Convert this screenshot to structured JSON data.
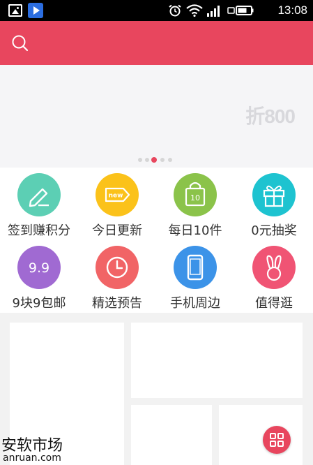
{
  "status_bar": {
    "time": "13:08",
    "icons": [
      "gallery-icon",
      "play-store-icon",
      "alarm-icon",
      "wifi-icon",
      "signal-icon",
      "battery-icon"
    ]
  },
  "header": {
    "search_icon": "search-icon",
    "color": "#e8465e"
  },
  "banner": {
    "logo_text": "折800",
    "page_count": 5,
    "active_index": 2
  },
  "categories": [
    {
      "label": "签到赚积分",
      "icon": "pencil-icon",
      "color": "#5ccfb4"
    },
    {
      "label": "今日更新",
      "icon": "new-tag-icon",
      "color": "#fbc21a",
      "badge": "new"
    },
    {
      "label": "每日10件",
      "icon": "bag-icon",
      "color": "#8bc34a",
      "badge": "10"
    },
    {
      "label": "0元抽奖",
      "icon": "gift-icon",
      "color": "#1ec3d0"
    },
    {
      "label": "9块9包邮",
      "icon": "nine-nine-icon",
      "color": "#a06ad2",
      "badge": "9.9"
    },
    {
      "label": "精选预告",
      "icon": "clock-icon",
      "color": "#f16466"
    },
    {
      "label": "手机周边",
      "icon": "phone-icon",
      "color": "#3c93e8"
    },
    {
      "label": "值得逛",
      "icon": "bunny-icon",
      "color": "#f05474"
    }
  ],
  "watermark": {
    "cn": "安软市场",
    "en": "anruan.com"
  },
  "fab": {
    "icon": "grid-icon"
  }
}
